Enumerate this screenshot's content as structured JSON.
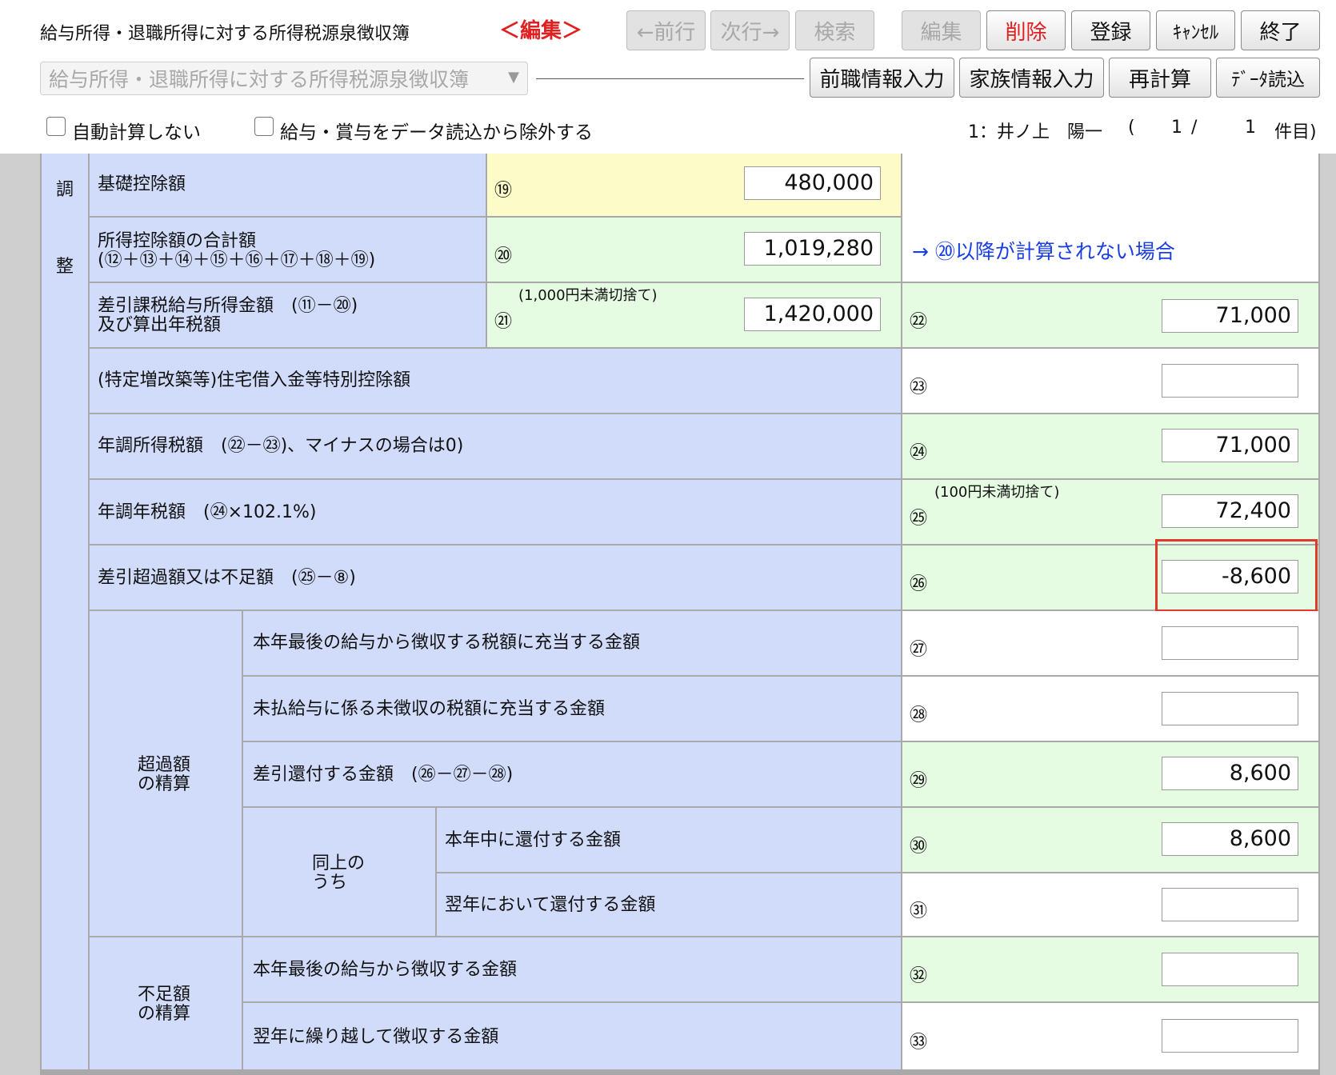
{
  "toolbar": {
    "title": "給与所得・退職所得に対する所得税源泉徴収簿",
    "mode_label": "＜編集＞",
    "buttons": {
      "prev": "←前行",
      "next": "次行→",
      "search": "検索",
      "edit": "編集",
      "delete": "削除",
      "register": "登録",
      "cancel": "ｷｬﾝｾﾙ",
      "exit": "終了",
      "prev_job": "前職情報入力",
      "family": "家族情報入力",
      "recalc": "再計算",
      "data_load": "ﾃﾞｰﾀ読込"
    },
    "select_value": "給与所得・退職所得に対する所得税源泉徴収簿",
    "checkbox_auto_calc": "自動計算しない",
    "checkbox_exclude": "給与・賞与をデータ読込から除外する",
    "status": {
      "employee": "1：井ノ上　陽一",
      "open": "(",
      "current": "1",
      "sep": "/",
      "total": "1",
      "suffix": "件目)"
    }
  },
  "form": {
    "section_label_1": "調",
    "section_label_2": "整",
    "hint": "→ ⑳以降が計算されない場合",
    "rows": {
      "r19": {
        "label": "基礎控除額",
        "num": "⑲",
        "value": "480,000"
      },
      "r20": {
        "label1": "所得控除額の合計額",
        "label2": "(⑫＋⑬＋⑭＋⑮＋⑯＋⑰＋⑱＋⑲)",
        "num": "⑳",
        "value": "1,019,280"
      },
      "r21": {
        "label1": "差引課税給与所得金額　(⑪－⑳)",
        "label2": "及び算出年税額",
        "note": "(1,000円未満切捨て)",
        "num": "㉑",
        "value": "1,420,000"
      },
      "r22": {
        "num": "㉒",
        "value": "71,000"
      },
      "r23": {
        "label": "(特定増改築等)住宅借入金等特別控除額",
        "num": "㉓",
        "value": ""
      },
      "r24": {
        "label": "年調所得税額　(㉒－㉓)、マイナスの場合は0)",
        "num": "㉔",
        "value": "71,000"
      },
      "r25": {
        "label": "年調年税額　(㉔×102.1%)",
        "note": "(100円未満切捨て)",
        "num": "㉕",
        "value": "72,400"
      },
      "r26": {
        "label": "差引超過額又は不足額　(㉕－⑧)",
        "num": "㉖",
        "value": "-8,600"
      },
      "r27": {
        "label": "本年最後の給与から徴収する税額に充当する金額",
        "num": "㉗",
        "value": ""
      },
      "r28": {
        "label": "未払給与に係る未徴収の税額に充当する金額",
        "num": "㉘",
        "value": ""
      },
      "r29": {
        "label": "差引還付する金額　(㉖－㉗－㉘)",
        "num": "㉙",
        "value": "8,600"
      },
      "r30": {
        "label": "本年中に還付する金額",
        "num": "㉚",
        "value": "8,600"
      },
      "r31": {
        "label": "翌年において還付する金額",
        "num": "㉛",
        "value": ""
      },
      "r32": {
        "label": "本年最後の給与から徴収する金額",
        "num": "㉜",
        "value": ""
      },
      "r33": {
        "label": "翌年に繰り越して徴収する金額",
        "num": "㉝",
        "value": ""
      }
    },
    "groups": {
      "excess_1": "超過額",
      "excess_2": "の精算",
      "same_1": "同上の",
      "same_2": "うち",
      "short_1": "不足額",
      "short_2": "の精算"
    }
  },
  "colors": {
    "label_bg": "#d1dcfa",
    "calc_bg": "#e5fbe2",
    "input_bg": "#fdfbc8",
    "highlight": "#e03a2a",
    "mode": "#e02020",
    "hint": "#1a3fe0"
  }
}
